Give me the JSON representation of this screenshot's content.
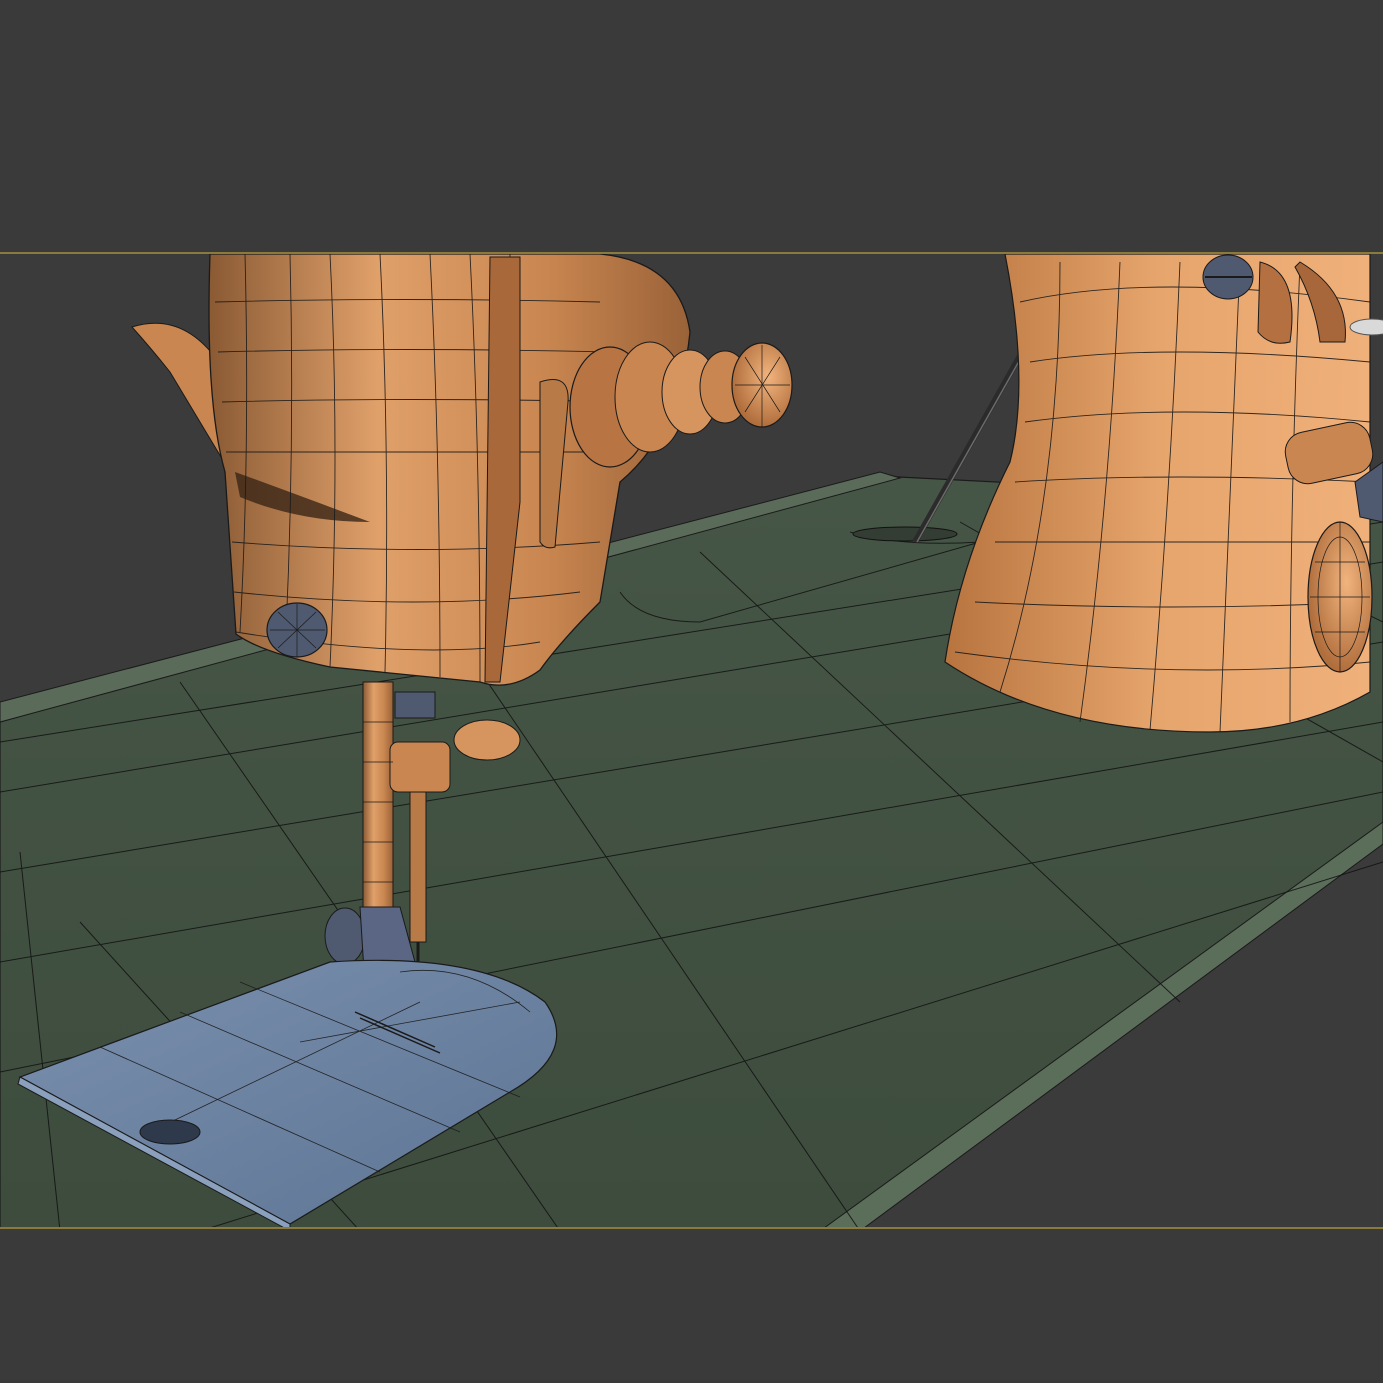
{
  "viewport": {
    "background_color": "#3a3a3a",
    "safe_frame_color": "#8a7a3c",
    "shading_mode": "Edged Faces"
  },
  "scene": {
    "objects": [
      {
        "name": "sewing-machine-head",
        "color": "#d6955f"
      },
      {
        "name": "machine-pillar",
        "color": "#d6955f"
      },
      {
        "name": "balance-wheel",
        "color": "#d6955f"
      },
      {
        "name": "presser-bar-and-needle",
        "color": "#d6955f"
      },
      {
        "name": "presser-foot",
        "color": "#d6955f"
      },
      {
        "name": "thumb-screw",
        "color": "#4f5a70"
      },
      {
        "name": "needle-plate",
        "color": "#6f86a6"
      },
      {
        "name": "table-top",
        "color": "#3f4e3f"
      }
    ],
    "wire_color": "#1a1a1a"
  }
}
